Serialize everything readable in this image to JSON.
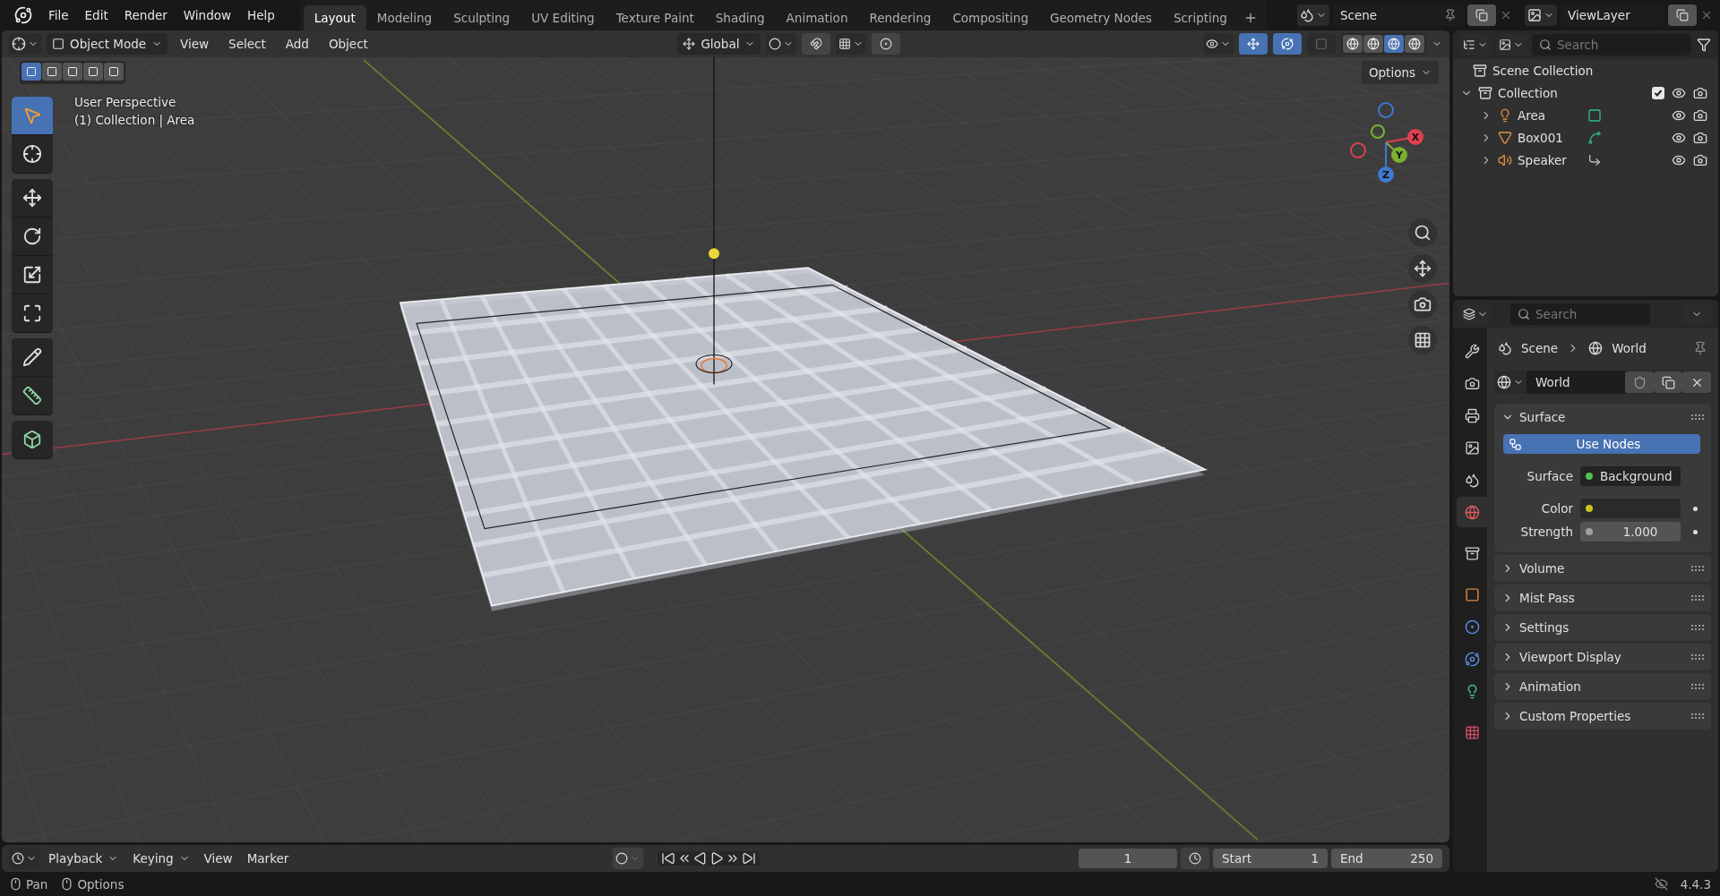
{
  "menu": [
    "File",
    "Edit",
    "Render",
    "Window",
    "Help"
  ],
  "workspaces": [
    {
      "label": "Layout",
      "selected": true
    },
    {
      "label": "Modeling",
      "selected": false
    },
    {
      "label": "Sculpting",
      "selected": false
    },
    {
      "label": "UV Editing",
      "selected": false
    },
    {
      "label": "Texture Paint",
      "selected": false
    },
    {
      "label": "Shading",
      "selected": false
    },
    {
      "label": "Animation",
      "selected": false
    },
    {
      "label": "Rendering",
      "selected": false
    },
    {
      "label": "Compositing",
      "selected": false
    },
    {
      "label": "Geometry Nodes",
      "selected": false
    },
    {
      "label": "Scripting",
      "selected": false
    }
  ],
  "scene": "Scene",
  "view_layer": "ViewLayer",
  "viewport": {
    "mode": "Object Mode",
    "menus": [
      "View",
      "Select",
      "Add",
      "Object"
    ],
    "orientation": "Global",
    "options": "Options",
    "overlay_text": [
      "User Perspective",
      "(1) Collection | Area"
    ],
    "select_modes": [
      {
        "selected": true
      },
      {
        "selected": false
      },
      {
        "selected": false
      },
      {
        "selected": false
      },
      {
        "selected": false
      }
    ],
    "shading": [
      {
        "selected": false
      },
      {
        "selected": false
      },
      {
        "selected": true
      },
      {
        "selected": false
      }
    ],
    "tools": [
      {
        "kind": "select",
        "selected": true
      },
      {
        "kind": "cursor",
        "selected": false
      },
      {
        "kind": "move",
        "selected": false
      },
      {
        "kind": "rotate",
        "selected": false
      },
      {
        "kind": "scale",
        "selected": false
      },
      {
        "kind": "transform",
        "selected": false
      },
      {
        "kind": "annotate",
        "selected": false
      },
      {
        "kind": "measure",
        "selected": false
      },
      {
        "kind": "add",
        "selected": false
      }
    ],
    "gizmo_labels": [
      "X",
      "Y",
      "Z"
    ]
  },
  "outliner": {
    "search_placeholder": "Search",
    "root": "Scene Collection",
    "items": [
      {
        "label": "Collection",
        "expanded": true,
        "checked": true,
        "children": [
          {
            "label": "Area",
            "kind": "light",
            "expanded": false
          },
          {
            "label": "Box001",
            "kind": "mesh",
            "expanded": false
          },
          {
            "label": "Speaker",
            "kind": "speaker",
            "expanded": false
          }
        ]
      }
    ]
  },
  "properties": {
    "search_placeholder": "Search",
    "breadcrumb": [
      "Scene",
      "World"
    ],
    "datablock": "World",
    "tabs": [
      {
        "kind": "tool",
        "selected": false
      },
      {
        "kind": "render",
        "selected": false
      },
      {
        "kind": "output",
        "selected": false
      },
      {
        "kind": "view_layer",
        "selected": false
      },
      {
        "kind": "scene",
        "selected": false
      },
      {
        "kind": "world",
        "selected": true
      },
      {
        "kind": "collection",
        "selected": false
      },
      {
        "kind": "object",
        "selected": false
      },
      {
        "kind": "modifiers",
        "selected": false
      },
      {
        "kind": "physics",
        "selected": false
      },
      {
        "kind": "data",
        "selected": false
      },
      {
        "kind": "texture",
        "selected": false
      }
    ],
    "use_nodes": "Use Nodes",
    "fields": [
      {
        "kind": "link",
        "label": "Surface",
        "value": "Background",
        "color": "#4fc14f"
      },
      {
        "kind": "color",
        "label": "Color",
        "color": "#c8c41e"
      },
      {
        "kind": "number",
        "label": "Strength",
        "value": "1.000",
        "color": "#a1a1a1"
      }
    ],
    "panels": [
      {
        "title": "Surface",
        "expanded": true
      },
      {
        "title": "Volume",
        "expanded": false
      },
      {
        "title": "Mist Pass",
        "expanded": false
      },
      {
        "title": "Settings",
        "expanded": false
      },
      {
        "title": "Viewport Display",
        "expanded": false
      },
      {
        "title": "Animation",
        "expanded": false
      },
      {
        "title": "Custom Properties",
        "expanded": false
      }
    ]
  },
  "timeline": {
    "menus": [
      {
        "label": "Playback",
        "dropdown": true
      },
      {
        "label": "Keying",
        "dropdown": true
      },
      {
        "label": "View",
        "dropdown": false
      },
      {
        "label": "Marker",
        "dropdown": false
      }
    ],
    "current_frame": "1",
    "start_label": "Start",
    "start": "1",
    "end_label": "End",
    "end": "250"
  },
  "status": {
    "hints": [
      "Pan",
      "Options"
    ],
    "version": "4.4.3"
  }
}
